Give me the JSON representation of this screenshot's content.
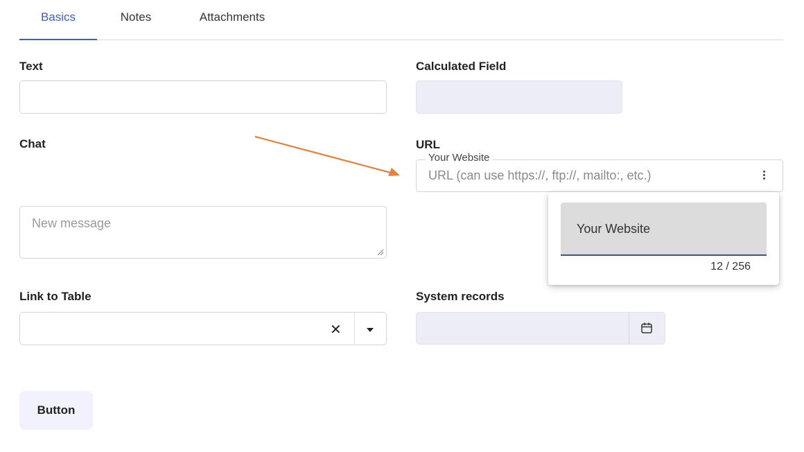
{
  "tabs": [
    {
      "label": "Basics",
      "active": true
    },
    {
      "label": "Notes",
      "active": false
    },
    {
      "label": "Attachments",
      "active": false
    }
  ],
  "fields": {
    "text": {
      "label": "Text",
      "value": ""
    },
    "calculated": {
      "label": "Calculated Field",
      "value": ""
    },
    "chat": {
      "label": "Chat",
      "placeholder": "New message"
    },
    "url": {
      "label": "URL",
      "legend": "Your Website",
      "placeholder": "URL (can use https://, ftp://, mailto:, etc.)"
    },
    "link_to_table": {
      "label": "Link to Table",
      "value": ""
    },
    "system_records": {
      "label": "System records",
      "value": ""
    }
  },
  "url_popup": {
    "value": "Your Website",
    "counter": "12 / 256"
  },
  "button": {
    "label": "Button"
  },
  "icons": {
    "more": "vertical-ellipsis-icon",
    "clear": "close-icon",
    "dropdown": "caret-down-icon",
    "calendar": "calendar-icon"
  },
  "colors": {
    "accent": "#3b5bdb",
    "annotation_arrow": "#e8813a",
    "disabled_bg": "#ecedf7",
    "button_bg": "#f1f2fd"
  }
}
